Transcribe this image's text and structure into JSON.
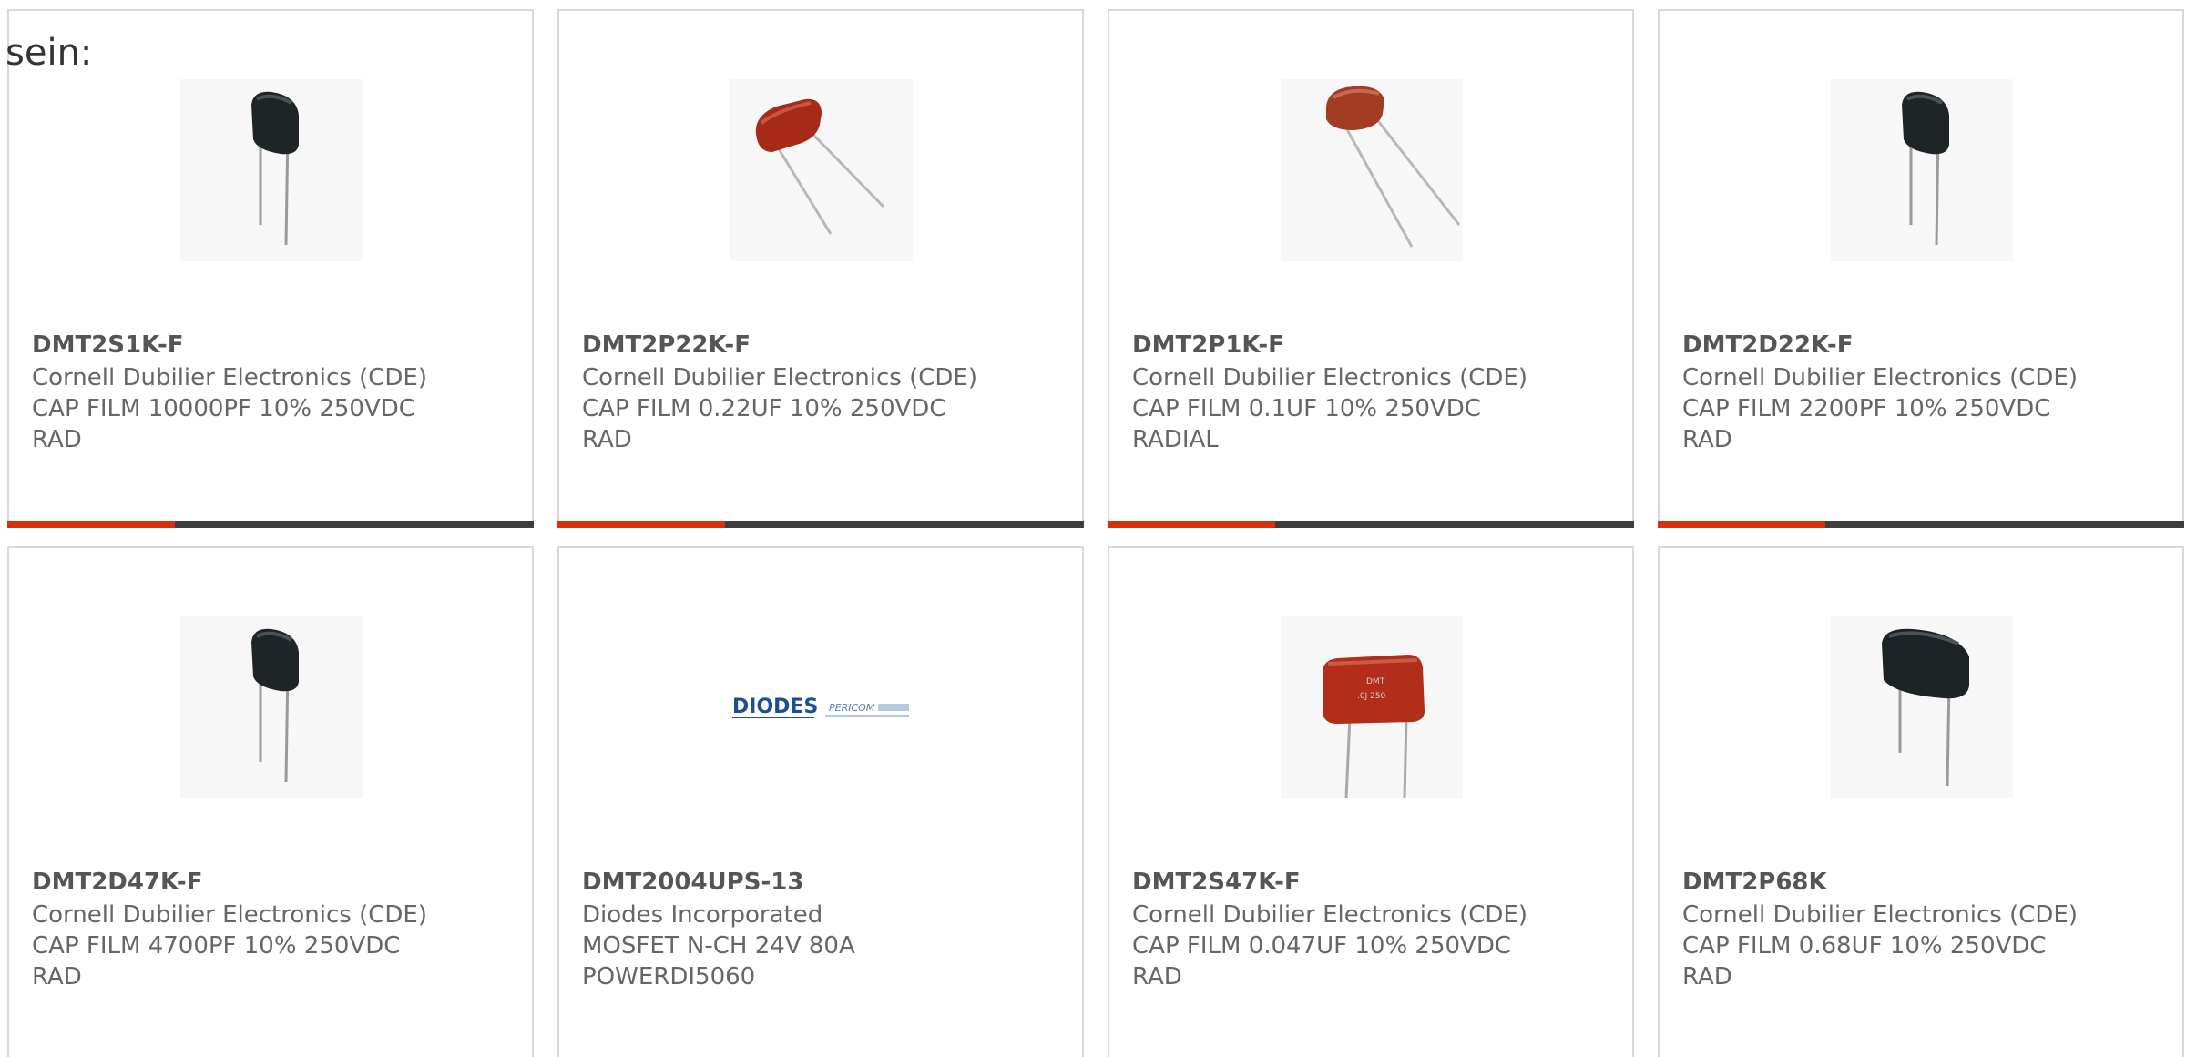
{
  "lead_text": "sein:",
  "colors": {
    "accent": "#d6300c",
    "bar": "#3d3d3d",
    "border": "#d9d9d9"
  },
  "products": [
    {
      "part": "DMT2S1K-F",
      "maker": "Cornell Dubilier Electronics (CDE)",
      "desc1": "CAP FILM 10000PF 10% 250VDC",
      "desc2": "RAD",
      "image": "black-film-capacitor"
    },
    {
      "part": "DMT2P22K-F",
      "maker": "Cornell Dubilier Electronics (CDE)",
      "desc1": "CAP FILM 0.22UF 10% 250VDC",
      "desc2": "RAD",
      "image": "red-film-capacitor"
    },
    {
      "part": "DMT2P1K-F",
      "maker": "Cornell Dubilier Electronics (CDE)",
      "desc1": "CAP FILM 0.1UF 10% 250VDC",
      "desc2": "RADIAL",
      "image": "red-film-capacitor"
    },
    {
      "part": "DMT2D22K-F",
      "maker": "Cornell Dubilier Electronics (CDE)",
      "desc1": "CAP FILM 2200PF 10% 250VDC",
      "desc2": "RAD",
      "image": "black-film-capacitor"
    },
    {
      "part": "DMT2D47K-F",
      "maker": "Cornell Dubilier Electronics (CDE)",
      "desc1": "CAP FILM 4700PF 10% 250VDC",
      "desc2": "RAD",
      "image": "black-film-capacitor"
    },
    {
      "part": "DMT2004UPS-13",
      "maker": "Diodes Incorporated",
      "desc1": "MOSFET N-CH 24V 80A",
      "desc2": "POWERDI5060",
      "image": "diodes-pericom-logo",
      "logo_left": "DIODES",
      "logo_right": "PERICOM"
    },
    {
      "part": "DMT2S47K-F",
      "maker": "Cornell Dubilier Electronics (CDE)",
      "desc1": "CAP FILM 0.047UF 10% 250VDC",
      "desc2": "RAD",
      "image": "red-box-capacitor"
    },
    {
      "part": "DMT2P68K",
      "maker": "Cornell Dubilier Electronics (CDE)",
      "desc1": "CAP FILM 0.68UF 10% 250VDC",
      "desc2": "RAD",
      "image": "black-film-capacitor-large"
    }
  ]
}
